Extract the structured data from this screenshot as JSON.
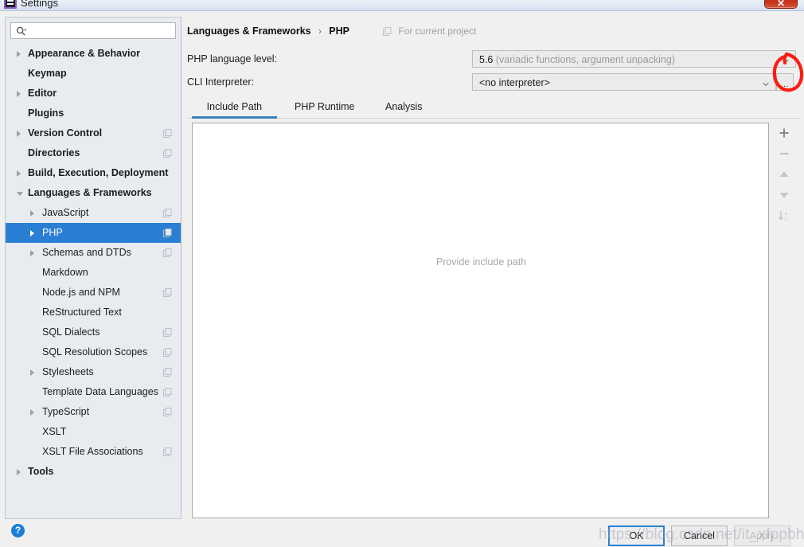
{
  "window": {
    "title": "Settings",
    "icon": "ide-app-icon",
    "close_label": "✕"
  },
  "sidebar": {
    "search": {
      "value": "",
      "placeholder": "",
      "icon": "search-icon"
    },
    "items": [
      {
        "label": "Appearance & Behavior",
        "depth": 0,
        "bold": true,
        "arrow": "collapsed",
        "config_icon": false,
        "selected": false
      },
      {
        "label": "Keymap",
        "depth": 0,
        "bold": true,
        "arrow": "none",
        "config_icon": false,
        "selected": false
      },
      {
        "label": "Editor",
        "depth": 0,
        "bold": true,
        "arrow": "collapsed",
        "config_icon": false,
        "selected": false
      },
      {
        "label": "Plugins",
        "depth": 0,
        "bold": true,
        "arrow": "none",
        "config_icon": false,
        "selected": false
      },
      {
        "label": "Version Control",
        "depth": 0,
        "bold": true,
        "arrow": "collapsed",
        "config_icon": true,
        "selected": false
      },
      {
        "label": "Directories",
        "depth": 0,
        "bold": true,
        "arrow": "none",
        "config_icon": true,
        "selected": false
      },
      {
        "label": "Build, Execution, Deployment",
        "depth": 0,
        "bold": true,
        "arrow": "collapsed",
        "config_icon": false,
        "selected": false
      },
      {
        "label": "Languages & Frameworks",
        "depth": 0,
        "bold": true,
        "arrow": "expanded",
        "config_icon": false,
        "selected": false
      },
      {
        "label": "JavaScript",
        "depth": 1,
        "bold": false,
        "arrow": "collapsed",
        "config_icon": true,
        "selected": false
      },
      {
        "label": "PHP",
        "depth": 1,
        "bold": false,
        "arrow": "collapsed",
        "config_icon": true,
        "selected": true
      },
      {
        "label": "Schemas and DTDs",
        "depth": 1,
        "bold": false,
        "arrow": "collapsed",
        "config_icon": true,
        "selected": false
      },
      {
        "label": "Markdown",
        "depth": 1,
        "bold": false,
        "arrow": "none",
        "config_icon": false,
        "selected": false
      },
      {
        "label": "Node.js and NPM",
        "depth": 1,
        "bold": false,
        "arrow": "none",
        "config_icon": true,
        "selected": false
      },
      {
        "label": "ReStructured Text",
        "depth": 1,
        "bold": false,
        "arrow": "none",
        "config_icon": false,
        "selected": false
      },
      {
        "label": "SQL Dialects",
        "depth": 1,
        "bold": false,
        "arrow": "none",
        "config_icon": true,
        "selected": false
      },
      {
        "label": "SQL Resolution Scopes",
        "depth": 1,
        "bold": false,
        "arrow": "none",
        "config_icon": true,
        "selected": false
      },
      {
        "label": "Stylesheets",
        "depth": 1,
        "bold": false,
        "arrow": "collapsed",
        "config_icon": true,
        "selected": false
      },
      {
        "label": "Template Data Languages",
        "depth": 1,
        "bold": false,
        "arrow": "none",
        "config_icon": true,
        "selected": false
      },
      {
        "label": "TypeScript",
        "depth": 1,
        "bold": false,
        "arrow": "collapsed",
        "config_icon": true,
        "selected": false
      },
      {
        "label": "XSLT",
        "depth": 1,
        "bold": false,
        "arrow": "none",
        "config_icon": false,
        "selected": false
      },
      {
        "label": "XSLT File Associations",
        "depth": 1,
        "bold": false,
        "arrow": "none",
        "config_icon": true,
        "selected": false
      },
      {
        "label": "Tools",
        "depth": 0,
        "bold": true,
        "arrow": "collapsed",
        "config_icon": false,
        "selected": false
      }
    ]
  },
  "pane": {
    "breadcrumb": {
      "root": "Languages & Frameworks",
      "separator": "›",
      "leaf": "PHP"
    },
    "project_scope": {
      "label": "For current project",
      "icon": "config-scope-icon"
    },
    "fields": [
      {
        "label": "PHP language level:",
        "value": "5.6",
        "value_hint": "(variadic functions, argument unpacking)",
        "control": "combobox"
      },
      {
        "label": "CLI Interpreter:",
        "value": "<no interpreter>",
        "value_hint": "",
        "control": "combobox"
      }
    ],
    "browse_button": {
      "label": "…",
      "name": "browse-interpreter-button"
    },
    "tabs": [
      {
        "label": "Include Path",
        "active": true
      },
      {
        "label": "PHP Runtime",
        "active": false
      },
      {
        "label": "Analysis",
        "active": false
      }
    ],
    "list": {
      "empty_message": "Provide include path",
      "items": []
    },
    "list_toolbar": [
      {
        "name": "add-button",
        "glyph": "+",
        "icon": "plus-icon"
      },
      {
        "name": "remove-button",
        "glyph": "−",
        "icon": "minus-icon"
      },
      {
        "name": "move-up-button",
        "glyph": "▲",
        "icon": "arrow-up-icon"
      },
      {
        "name": "move-down-button",
        "glyph": "▼",
        "icon": "arrow-down-icon"
      },
      {
        "name": "sort-button",
        "glyph": "↓az",
        "icon": "sort-alpha-icon"
      }
    ]
  },
  "footer": {
    "help_label": "?",
    "ok_label": "OK",
    "cancel_label": "Cancel",
    "apply_label": "Apply"
  },
  "annotation": {
    "watermark_text": "https://blog.csdn.net/it_xfppbhou",
    "highlight_color": "#fc1c10",
    "highlight_target": "browse-interpreter-button"
  },
  "colors": {
    "accent": "#2a7fd4",
    "tab_underline": "#3a7fc1",
    "sidebar_bg": "#e8ecf0",
    "panel_bg": "#ffffff",
    "window_bg": "#f0f0f0"
  }
}
